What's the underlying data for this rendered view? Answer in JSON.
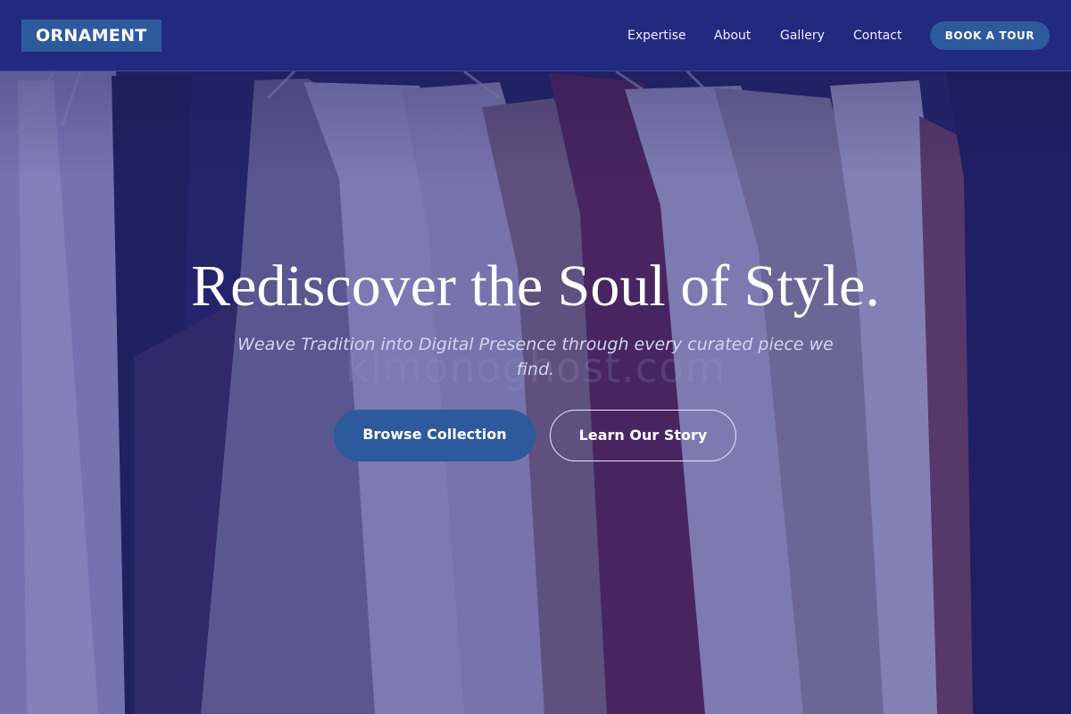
{
  "brand": {
    "logo_text": "ORNAMENT"
  },
  "nav": {
    "links": [
      {
        "label": "Expertise"
      },
      {
        "label": "About"
      },
      {
        "label": "Gallery"
      },
      {
        "label": "Contact"
      }
    ],
    "cta_label": "BOOK A TOUR"
  },
  "hero": {
    "title": "Rediscover the Soul of Style.",
    "subtitle": "Weave Tradition into Digital Presence through every curated piece we find.",
    "watermark": "kimonoghost.com",
    "primary_button": "Browse Collection",
    "secondary_button": "Learn Our Story"
  },
  "colors": {
    "accent": "#2c5a9c",
    "nav_background": "#242a80",
    "overlay": "#28288c"
  },
  "background_image": "clothing-rack-photo"
}
